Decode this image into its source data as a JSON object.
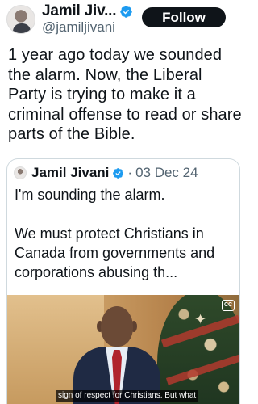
{
  "author": {
    "name": "Jamil Jiv...",
    "handle": "@jamiljivani",
    "follow_label": "Follow",
    "verified_color": "#1d9bf0"
  },
  "tweet": {
    "text": "1 year ago today we sounded the alarm. Now, the Liberal Party is trying to make it a criminal offense to read or share parts of the Bible."
  },
  "quote": {
    "name": "Jamil Jivani",
    "separator": "·",
    "date": "03 Dec 24",
    "paragraph1": "I'm sounding the alarm.",
    "paragraph2": "We must protect Christians in Canada from governments and corporations abusing th...",
    "video": {
      "cc_label": "CC",
      "caption": "sign of respect for Christians. But what"
    }
  }
}
